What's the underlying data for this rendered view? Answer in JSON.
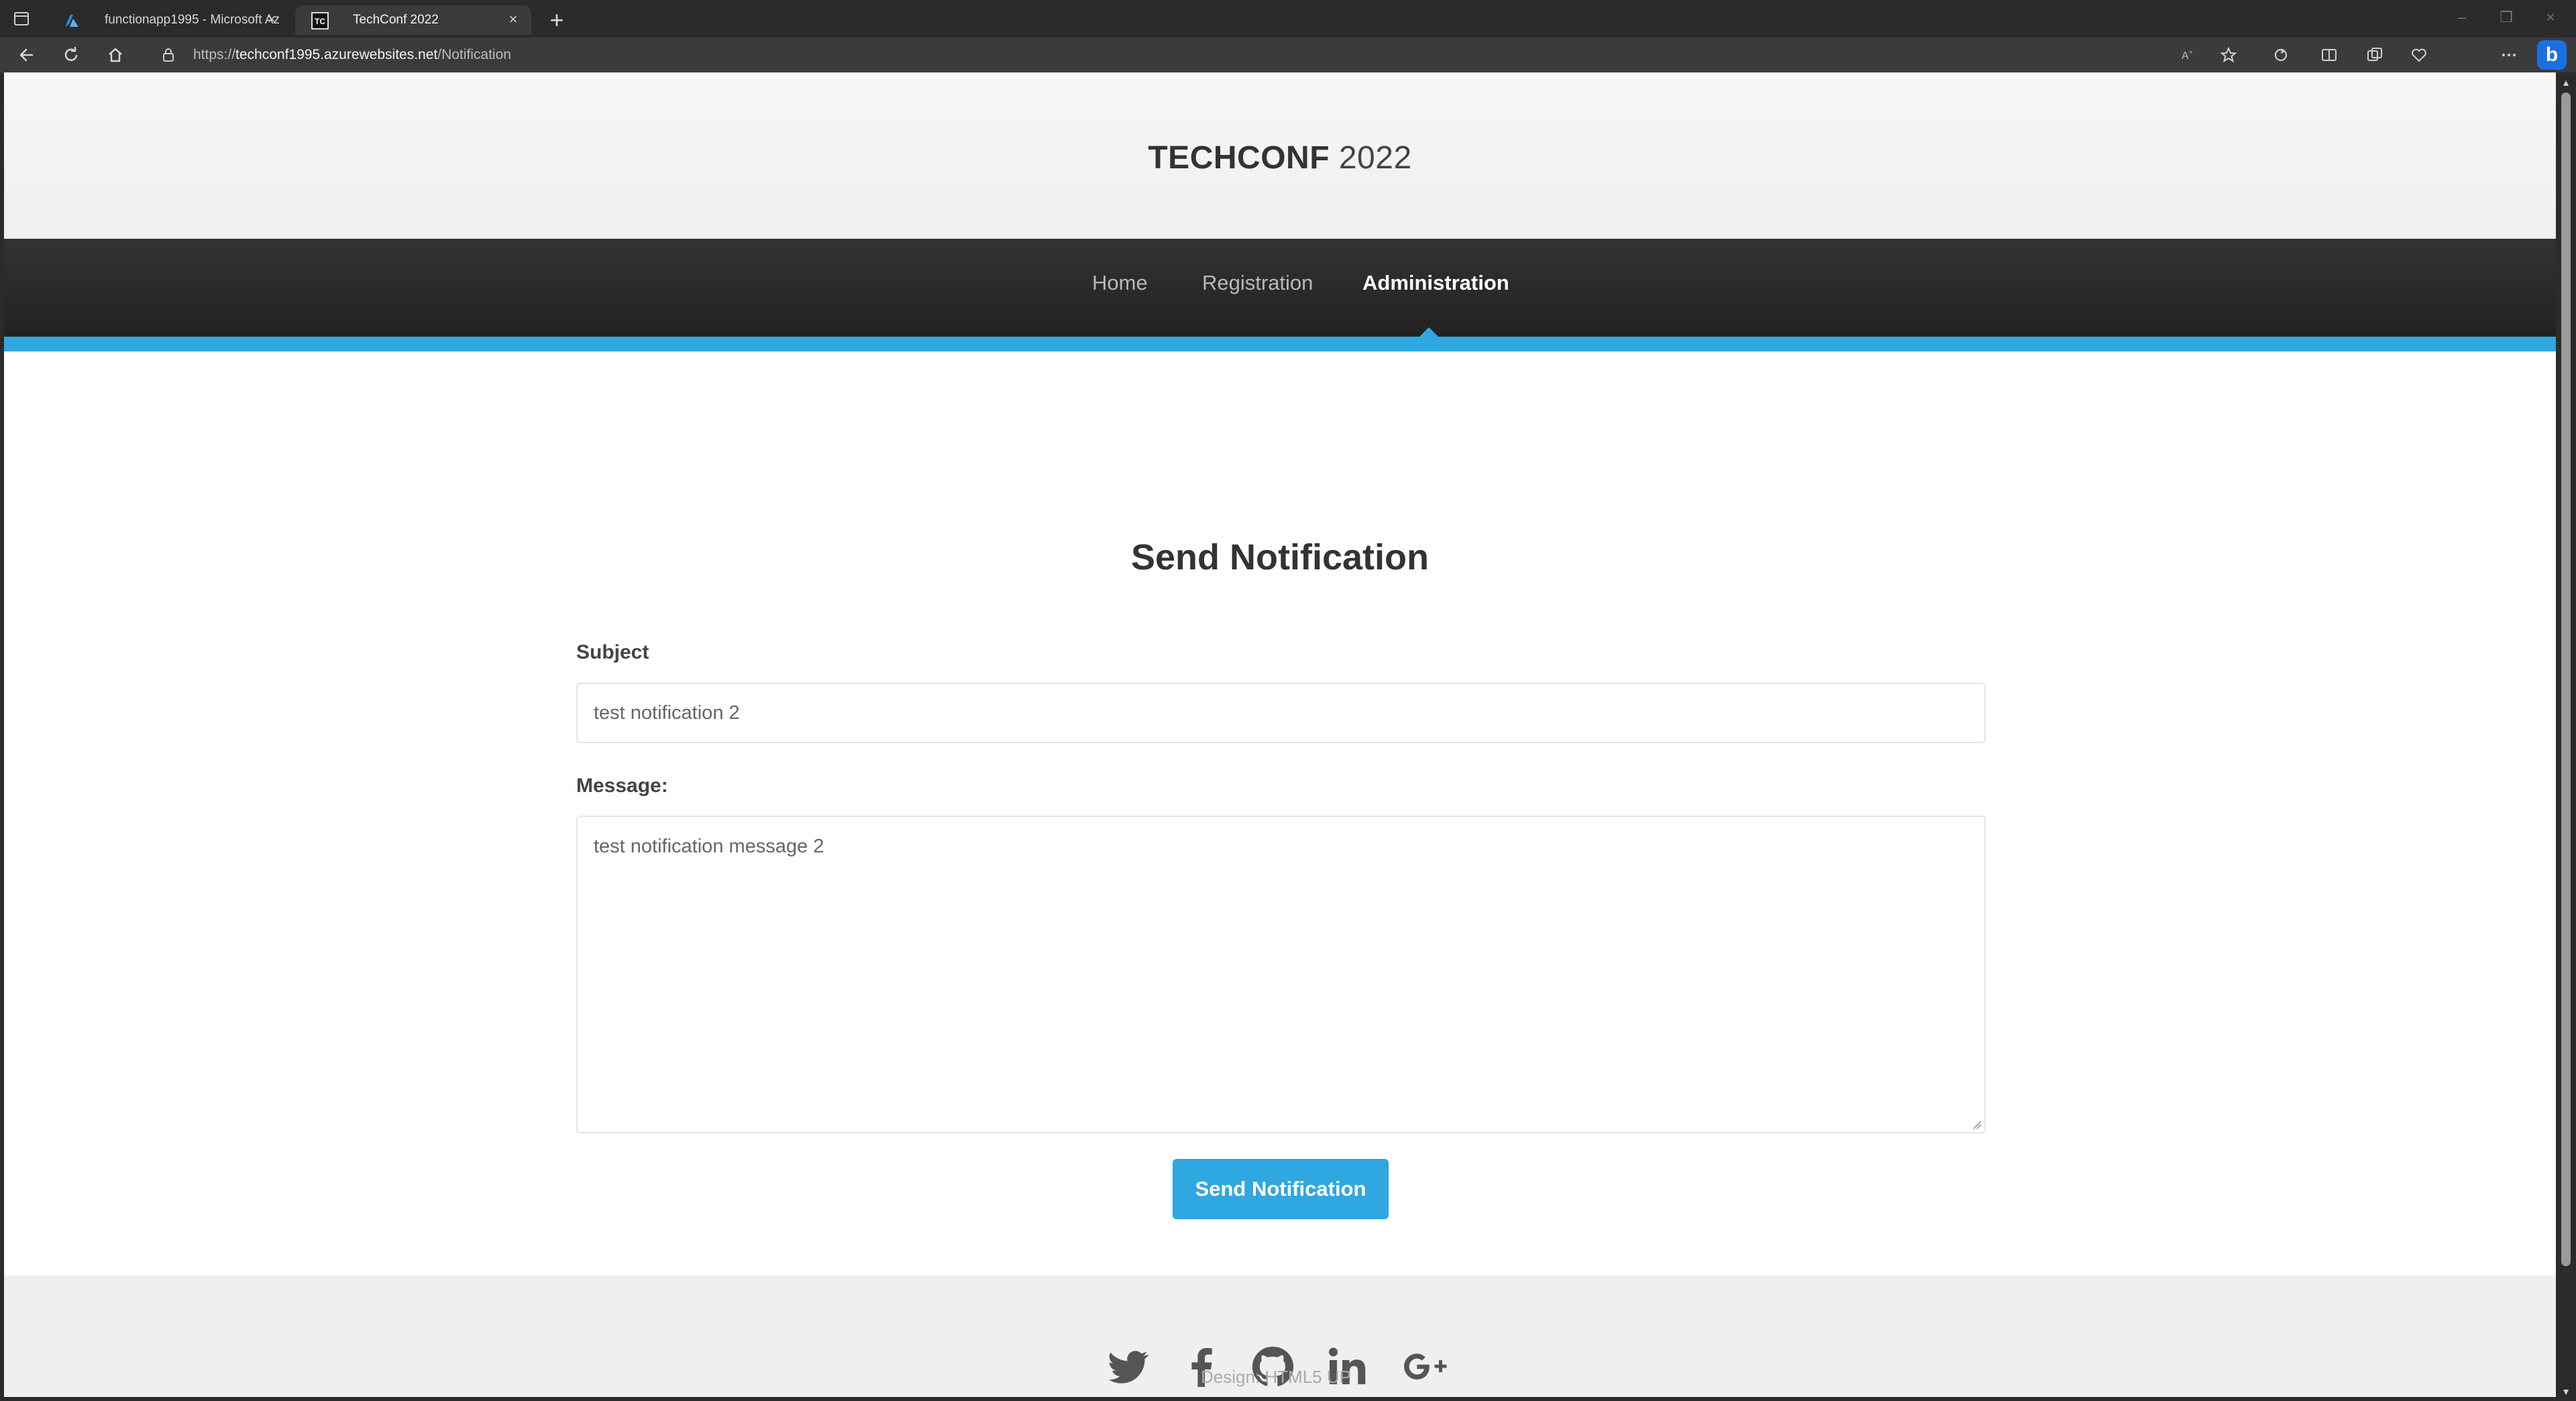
{
  "browser": {
    "tabs": [
      {
        "title": "functionapp1995 - Microsoft Az",
        "favicon": "azure-icon",
        "active": false
      },
      {
        "title": "TechConf 2022",
        "favicon": "tc-icon",
        "active": true
      }
    ],
    "address": {
      "scheme": "https://",
      "host": "techconf1995.azurewebsites.net",
      "path": "/Notification"
    }
  },
  "site": {
    "brand_bold": "TECHCONF",
    "brand_year": "2022",
    "nav": [
      {
        "label": "Home",
        "active": false
      },
      {
        "label": "Registration",
        "active": false
      },
      {
        "label": "Administration",
        "active": true
      }
    ],
    "accent_color": "#2fa7e0"
  },
  "form": {
    "title": "Send Notification",
    "subject_label": "Subject",
    "subject_value": "test notification 2",
    "message_label": "Message:",
    "message_value": "test notification message 2",
    "submit_label": "Send Notification"
  },
  "footer": {
    "social_icons": [
      "twitter-icon",
      "facebook-icon",
      "github-icon",
      "linkedin-icon",
      "google-plus-icon"
    ],
    "credit": "Design: HTML5 UP"
  }
}
